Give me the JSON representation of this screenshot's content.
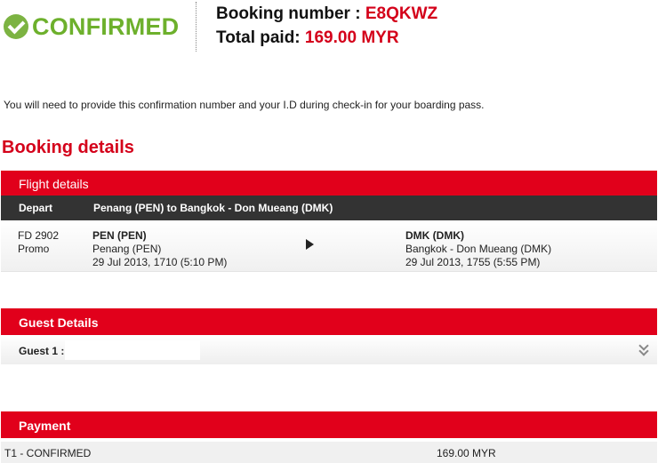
{
  "header": {
    "status": "CONFIRMED",
    "booking_label": "Booking number : ",
    "booking_number": "E8QKWZ",
    "total_label": "Total paid: ",
    "total_amount": "169.00 MYR",
    "status_color": "#6db02c",
    "accent_color": "#d4001a"
  },
  "notice": "You will need to provide this confirmation number and your I.D during check-in for your boarding pass.",
  "section_title": "Booking details",
  "flight": {
    "bar_title": "Flight details",
    "depart_label": "Depart",
    "route": "Penang (PEN) to Bangkok - Don Mueang (DMK)",
    "flight_number": "FD 2902",
    "fare_type": "Promo",
    "origin_code": "PEN (PEN)",
    "origin_city": "Penang (PEN)",
    "origin_time": "29 Jul 2013, 1710 (5:10 PM)",
    "dest_code": "DMK (DMK)",
    "dest_city": "Bangkok - Don Mueang (DMK)",
    "dest_time": "29 Jul 2013, 1755 (5:55 PM)"
  },
  "guest": {
    "bar_title": "Guest Details",
    "guest_label": "Guest 1 :",
    "guest_value": ""
  },
  "payment": {
    "bar_title": "Payment",
    "status": "T1 - CONFIRMED",
    "amount": "169.00 MYR"
  }
}
